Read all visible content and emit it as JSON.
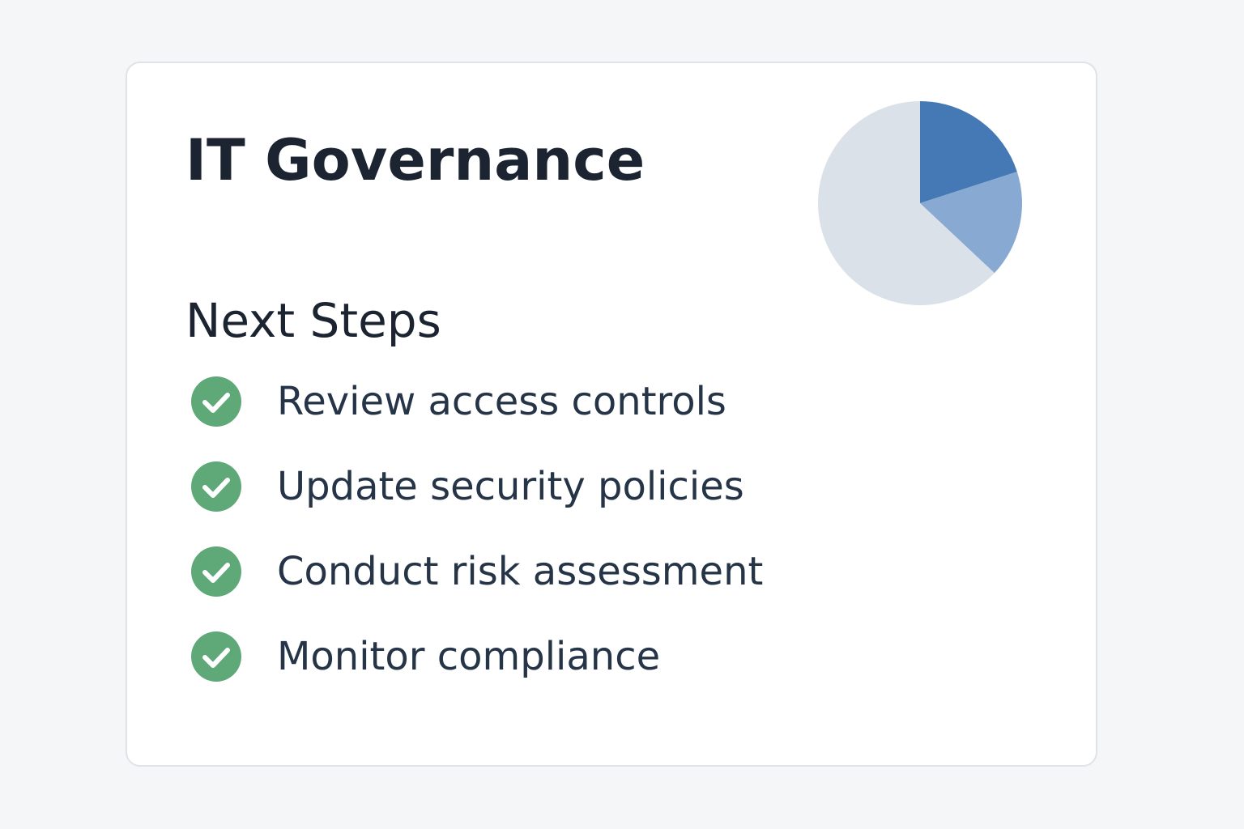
{
  "card": {
    "title": "IT Governance",
    "section_title": "Next Steps",
    "steps": [
      {
        "label": "Review access controls",
        "icon": "check-circle-icon",
        "done": true
      },
      {
        "label": "Update security policies",
        "icon": "check-circle-icon",
        "done": true
      },
      {
        "label": "Conduct risk assessment",
        "icon": "check-circle-icon",
        "done": true
      },
      {
        "label": "Monitor compliance",
        "icon": "check-circle-icon",
        "done": true
      }
    ]
  },
  "colors": {
    "page_background": "#f5f6f8",
    "card_background": "#ffffff",
    "card_border": "#dfe2e6",
    "text_primary": "#1b2430",
    "text_step": "#253447",
    "check_green": "#5fa878"
  },
  "chart_data": {
    "type": "pie",
    "start_angle_deg": 0,
    "direction": "clockwise",
    "legend": "none",
    "slices": [
      {
        "value": 20,
        "color": "#4479b5"
      },
      {
        "value": 17,
        "color": "#88a9d1"
      },
      {
        "value": 63,
        "color": "#dbe1e9"
      }
    ]
  }
}
